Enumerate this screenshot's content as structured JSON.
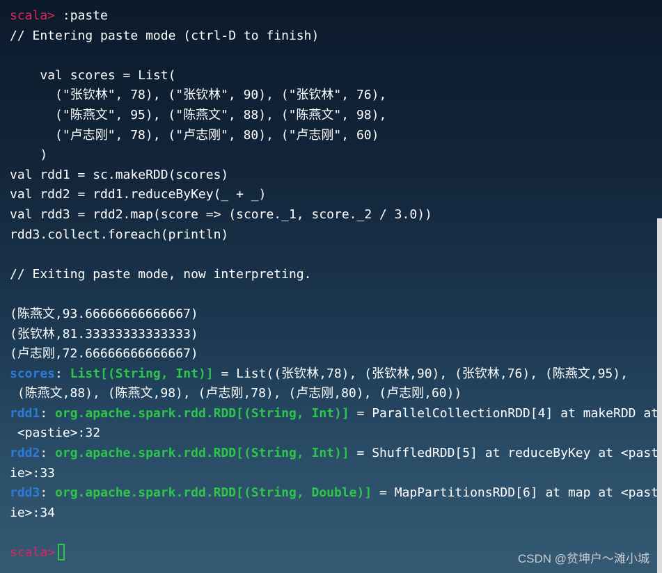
{
  "prompt": "scala>",
  "command": ":paste",
  "entering_msg": "// Entering paste mode (ctrl-D to finish)",
  "code_lines": [
    "    val scores = List(",
    "      (\"张钦林\", 78), (\"张钦林\", 90), (\"张钦林\", 76),",
    "      (\"陈燕文\", 95), (\"陈燕文\", 88), (\"陈燕文\", 98),",
    "      (\"卢志刚\", 78), (\"卢志刚\", 80), (\"卢志刚\", 60)",
    "    )",
    "val rdd1 = sc.makeRDD(scores)",
    "val rdd2 = rdd1.reduceByKey(_ + _)",
    "val rdd3 = rdd2.map(score => (score._1, score._2 / 3.0))",
    "rdd3.collect.foreach(println)"
  ],
  "exiting_msg": "// Exiting paste mode, now interpreting.",
  "output_lines": [
    "(陈燕文,93.66666666666667)",
    "(张钦林,81.33333333333333)",
    "(卢志刚,72.66666666666667)"
  ],
  "scores_result": {
    "name": "scores",
    "type": "List[(String, Int)]",
    "value_line1": " = List((张钦林,78), (张钦林,90), (张钦林,76), (陈燕文,95),",
    "value_line2": " (陈燕文,88), (陈燕文,98), (卢志刚,78), (卢志刚,80), (卢志刚,60))"
  },
  "rdd1_result": {
    "name": "rdd1",
    "type": "org.apache.spark.rdd.RDD[(String, Int)]",
    "value_line1": " = ParallelCollectionRDD[4] at makeRDD at",
    "value_line2": " <pastie>:32"
  },
  "rdd2_result": {
    "name": "rdd2",
    "type": "org.apache.spark.rdd.RDD[(String, Int)]",
    "value_line1": " = ShuffledRDD[5] at reduceByKey at <past",
    "value_line2": "ie>:33"
  },
  "rdd3_result": {
    "name": "rdd3",
    "type": "org.apache.spark.rdd.RDD[(String, Double)]",
    "value_line1": " = MapPartitionsRDD[6] at map at <past",
    "value_line2": "ie>:34"
  },
  "watermark": "CSDN @贫坤户～滩小城",
  "colors": {
    "prompt": "#e0245e",
    "identifier": "#2f7ad9",
    "type": "#2ec64a",
    "text": "#ffffff"
  }
}
